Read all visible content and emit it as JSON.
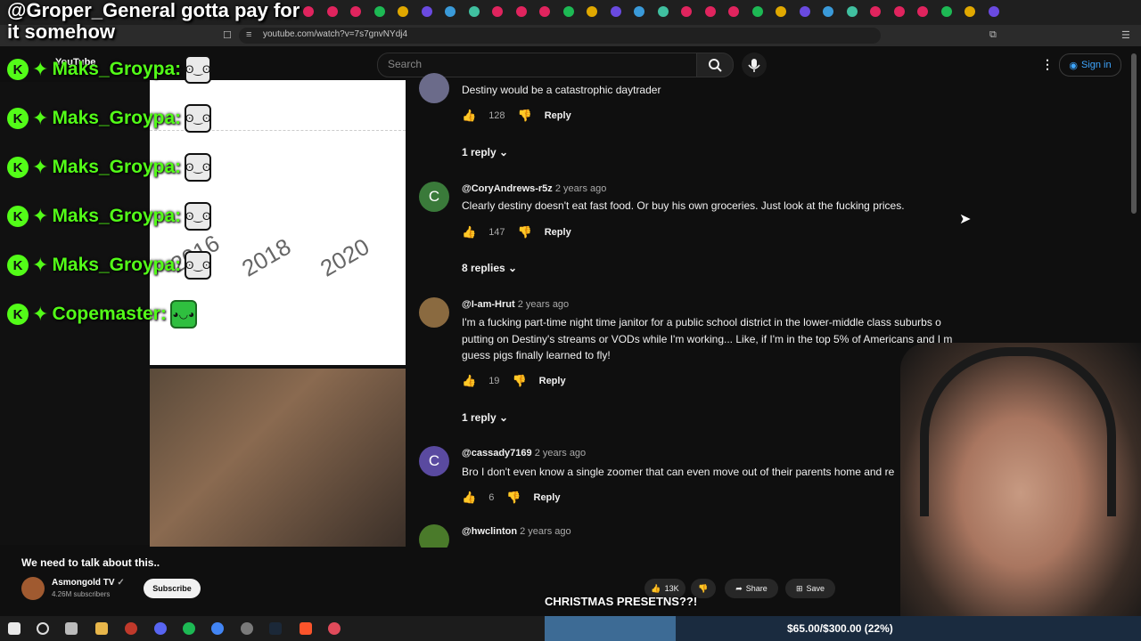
{
  "overlay": {
    "top_message": "@Groper_General gotta pay for it somehow",
    "chat": [
      {
        "user": "Maks_Groypa:",
        "emote": "wojak-emote"
      },
      {
        "user": "Maks_Groypa:",
        "emote": "wojak-emote"
      },
      {
        "user": "Maks_Groypa:",
        "emote": "wojak-emote"
      },
      {
        "user": "Maks_Groypa:",
        "emote": "wojak-emote"
      },
      {
        "user": "Maks_Groypa:",
        "emote": "wojak-emote"
      },
      {
        "user": "Copemaster:",
        "emote": "pepe-emote"
      }
    ],
    "badge_letter": "K",
    "goal": {
      "text": "$65.00/$300.00 (22%)",
      "fraction": 0.22
    },
    "stream_caption": "CHRISTMAS PRESETNS??!"
  },
  "browser": {
    "url": "youtube.com/watch?v=7s7gnvNYdj4"
  },
  "youtube": {
    "logo_text": "YouTube",
    "search_placeholder": "Search",
    "sign_in": "Sign in",
    "chart_years": [
      "2016",
      "2018",
      "2020"
    ],
    "video_title": "We need to talk about this..",
    "channel": {
      "name": "Asmongold TV",
      "subscribers": "4.26M subscribers"
    },
    "subscribe_label": "Subscribe",
    "likes": "13K",
    "share_label": "Share",
    "save_label": "Save"
  },
  "comments": [
    {
      "handle": "",
      "age": "",
      "text": "Destiny would be a catastrophic daytrader",
      "likes": "128",
      "reply_label": "Reply",
      "replies": "1 reply",
      "avatar_letter": "",
      "avatar_color": "#6b6b8a"
    },
    {
      "handle": "@CoryAndrews-r5z",
      "age": "2 years ago",
      "text": "Clearly destiny doesn't eat fast food. Or buy his own groceries. Just look at the fucking prices.",
      "likes": "147",
      "reply_label": "Reply",
      "replies": "8 replies",
      "avatar_letter": "C",
      "avatar_color": "#3a7a3a"
    },
    {
      "handle": "@I-am-Hrut",
      "age": "2 years ago",
      "text": "I'm a fucking part-time night time janitor for a public school district in the lower-middle class suburbs o\nputting on Destiny's streams or VODs while I'm working... Like, if I'm in the top 5% of Americans and I m\nguess pigs finally learned to fly!",
      "likes": "19",
      "reply_label": "Reply",
      "replies": "1 reply",
      "avatar_letter": "",
      "avatar_color": "#8a6a40"
    },
    {
      "handle": "@cassady7169",
      "age": "2 years ago",
      "text": "Bro I don't even know a single zoomer that can even move out of their parents home and re",
      "likes": "6",
      "reply_label": "Reply",
      "replies": "",
      "avatar_letter": "C",
      "avatar_color": "#5a4aa0"
    },
    {
      "handle": "@hwclinton",
      "age": "2 years ago",
      "text": "",
      "likes": "",
      "reply_label": "",
      "replies": "",
      "avatar_letter": "",
      "avatar_color": "#4a7a2a"
    }
  ]
}
